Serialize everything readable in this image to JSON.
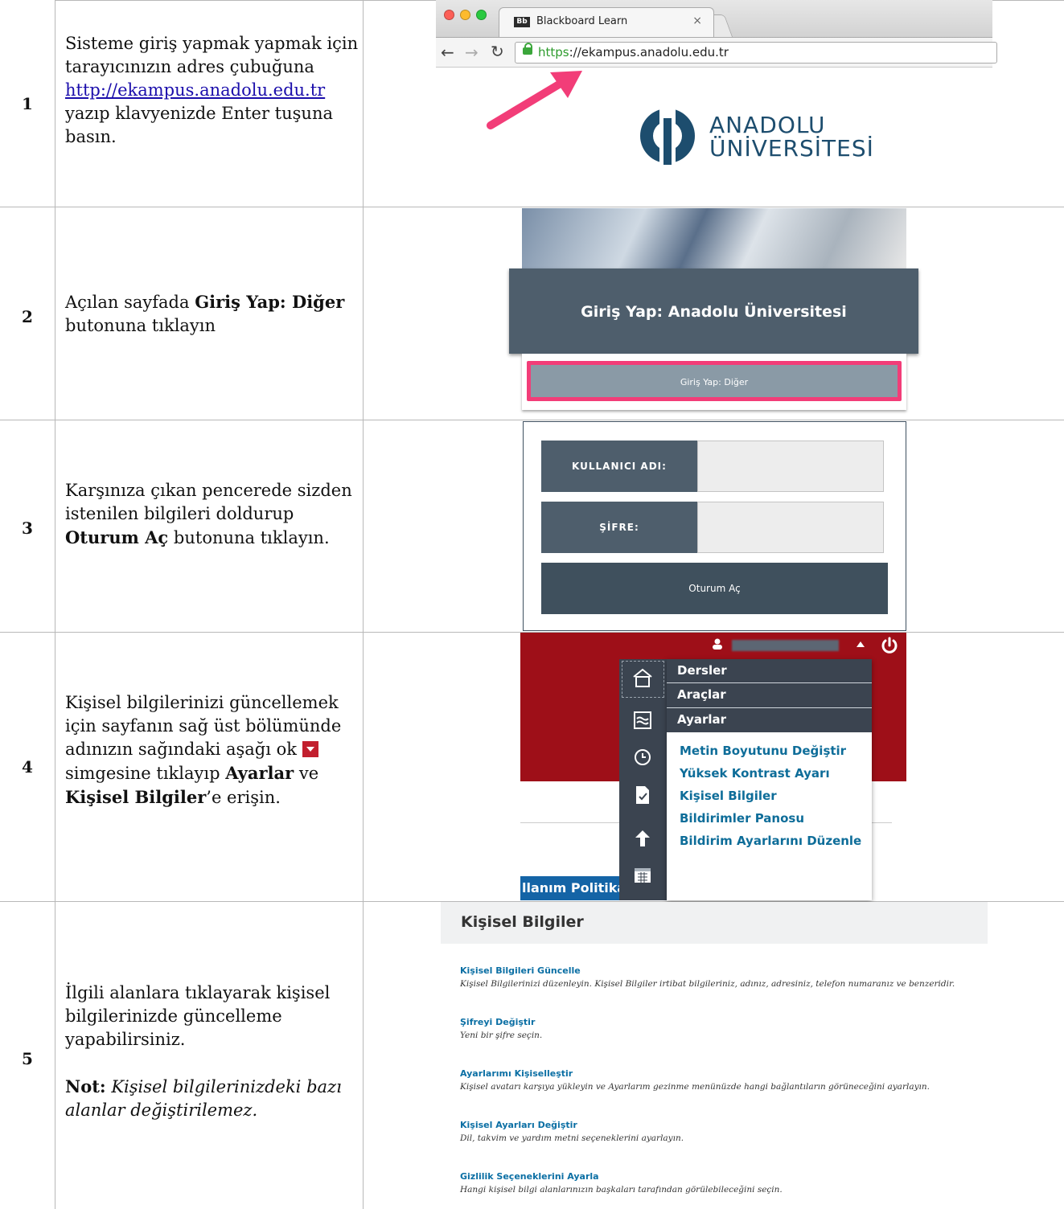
{
  "rows": [
    {
      "number": "1",
      "text_a": "Sisteme giriş yapmak yapmak için tarayıcınızın adres çubuğuna",
      "link": "http://ekampus.anadolu.edu.tr",
      "text_b": "yazıp klavyenizde Enter tuşuna basın."
    },
    {
      "number": "2",
      "text_a": "Açılan sayfada",
      "bold": "Giriş Yap: Diğer",
      "text_b": "butonuna tıklayın"
    },
    {
      "number": "3",
      "text_a": "Karşınıza çıkan pencerede sizden istenilen bilgileri doldurup",
      "bold": "Oturum Aç",
      "text_b": "butonuna tıklayın."
    },
    {
      "number": "4",
      "text_a": "Kişisel bilgilerinizi güncellemek için sayfanın sağ üst bölümünde adınızın sağındaki aşağı ok",
      "text_b": "simgesine tıklayıp",
      "bold_a": "Ayarlar",
      "text_c": "ve",
      "bold_b": "Kişisel Bilgiler",
      "text_d": "’e erişin."
    },
    {
      "number": "5",
      "text_a": "İlgili alanlara tıklayarak kişisel bilgilerinizde güncelleme yapabilirsiniz.",
      "note_label": "Not:",
      "note_text": "Kişisel bilgilerinizdeki bazı alanlar değiştirilemez."
    }
  ],
  "browser": {
    "tab_icon": "Bb",
    "tab_title": "Blackboard Learn",
    "tab_close": "×",
    "url_scheme": "https",
    "url_rest": "://ekampus.anadolu.edu.tr"
  },
  "logo": {
    "line1": "ANADOLU",
    "line2": "ÜNİVERSİTESİ"
  },
  "login": {
    "primary_button": "Giriş Yap: Anadolu Üniversitesi",
    "other_button": "Giriş Yap: Diğer",
    "username_label": "KULLANICI ADI:",
    "password_label": "ŞİFRE:",
    "submit_label": "Oturum Aç"
  },
  "menu": {
    "sections": [
      "Dersler",
      "Araçlar",
      "Ayarlar"
    ],
    "settings_items": [
      "Metin Boyutunu Değiştir",
      "Yüksek Kontrast Ayarı",
      "Kişisel Bilgiler",
      "Bildirimler Panosu",
      "Bildirim Ayarlarını Düzenle"
    ],
    "bottom_link": "llanım Politikası"
  },
  "personal_info": {
    "title": "Kişisel Bilgiler",
    "items": [
      {
        "link": "Kişisel Bilgileri Güncelle",
        "desc": "Kişisel Bilgilerinizi düzenleyin. Kişisel Bilgiler irtibat bilgileriniz, adınız, adresiniz, telefon numaranız ve benzeridir."
      },
      {
        "link": "Şifreyi Değiştir",
        "desc": "Yeni bir şifre seçin."
      },
      {
        "link": "Ayarlarımı Kişiselleştir",
        "desc": "Kişisel avatarı karşıya yükleyin ve Ayarlarım gezinme menünüzde hangi bağlantıların görüneceğini ayarlayın."
      },
      {
        "link": "Kişisel Ayarları Değiştir",
        "desc": "Dil, takvim ve yardım metni seçeneklerini ayarlayın."
      },
      {
        "link": "Gizlilik Seçeneklerini Ayarla",
        "desc": "Hangi kişisel bilgi alanlarınızın başkaları tarafından görülebileceğini seçin."
      }
    ]
  },
  "colors": {
    "accent_pink": "#f23d78",
    "slate": "#4e5e6c",
    "menu_dark": "#3b4450",
    "bb_red": "#9e0f18",
    "link_teal": "#0e6d99"
  }
}
